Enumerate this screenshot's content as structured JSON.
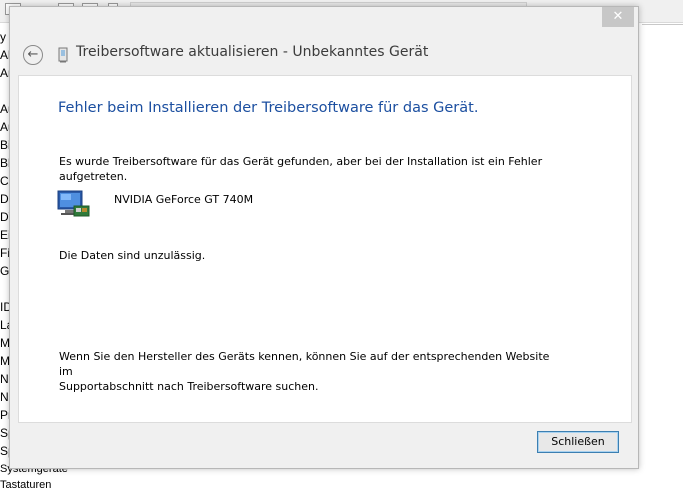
{
  "background_window": {
    "tree_items": [
      "y",
      "Ak",
      "An",
      "",
      "Au",
      "Au",
      "Bi",
      "Bl",
      "Co",
      "Dr",
      "DV",
      "Ein",
      "Fir",
      "Gr",
      "",
      "ID",
      "La",
      "M",
      "M",
      "Na",
      "Ne",
      "Pr",
      "Sp",
      "Sp"
    ],
    "bottom_items": [
      "Systemgeräte",
      "Tastaturen"
    ]
  },
  "dialog": {
    "close_glyph": "✕",
    "back_glyph": "←",
    "title": "Treibersoftware aktualisieren - Unbekanntes Gerät",
    "heading": "Fehler beim Installieren der Treibersoftware für das Gerät.",
    "message_line1": "Es wurde Treibersoftware für das Gerät gefunden, aber bei der Installation ist ein Fehler",
    "message_line2": "aufgetreten.",
    "device_name": "NVIDIA GeForce GT 740M",
    "error_detail": "Die Daten sind unzulässig.",
    "help_line1": "Wenn Sie den Hersteller des Geräts kennen, können Sie auf der entsprechenden Website im",
    "help_line2": "Supportabschnitt nach Treibersoftware suchen.",
    "close_button_label": "Schließen"
  },
  "colors": {
    "heading": "#1c4fa0",
    "button_border": "#3c7fb1",
    "close_button_bg": "#c7c7c7"
  },
  "icons": {
    "title_icon": "device-icon",
    "device_icon": "monitor-card-icon"
  }
}
